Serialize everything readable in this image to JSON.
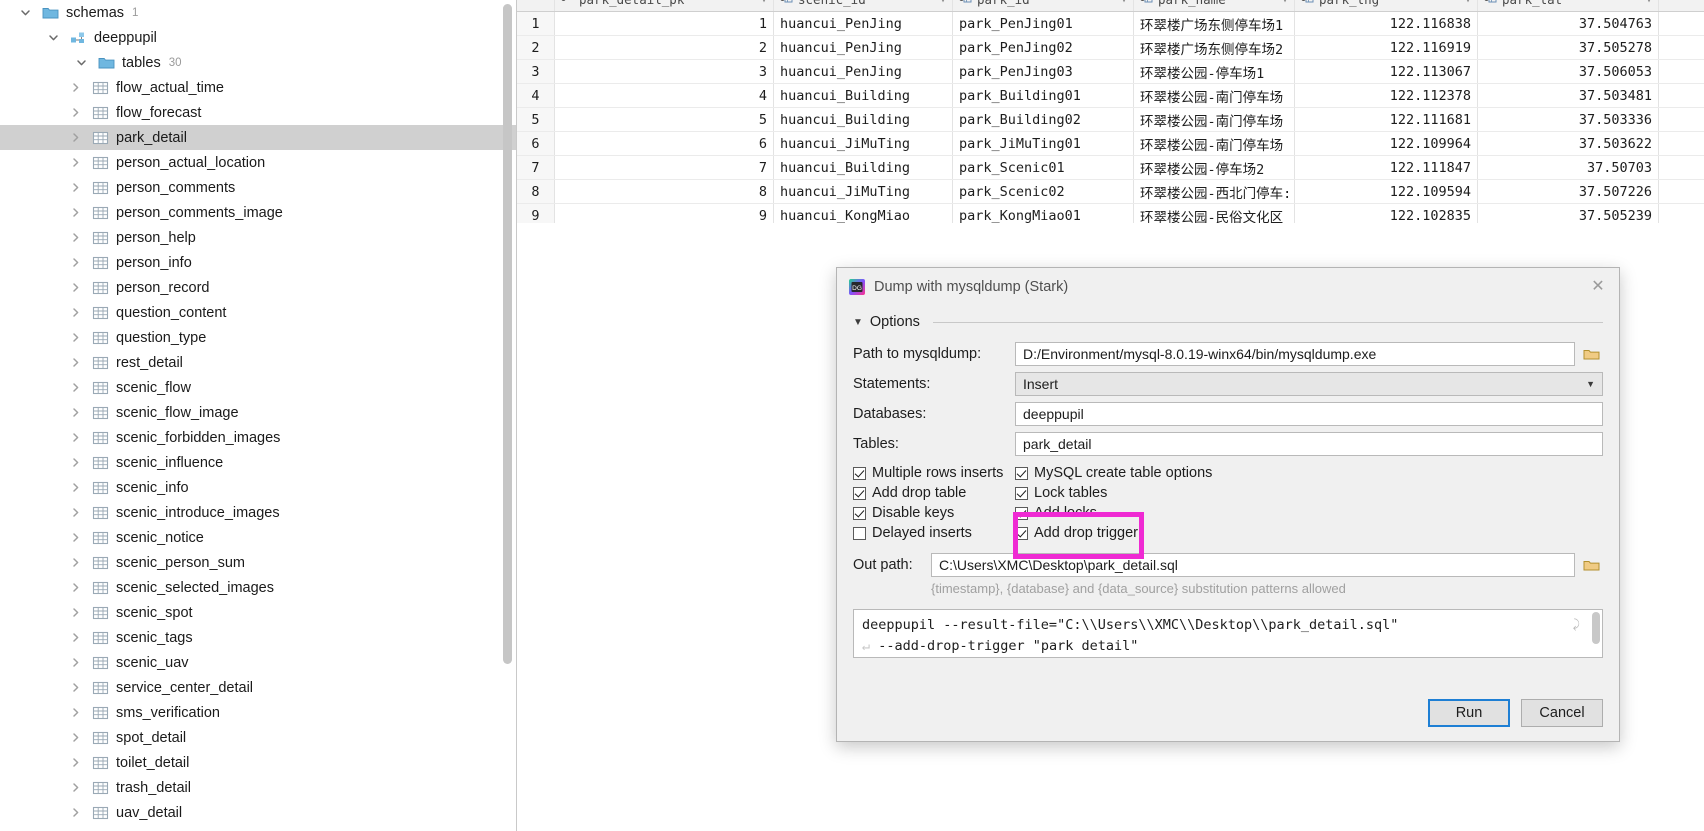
{
  "sidebar": {
    "nodes": [
      {
        "label": "schemas",
        "count": "1",
        "indent": 0,
        "icon": "folder-icon",
        "twisty": "down",
        "selected": false
      },
      {
        "label": "deeppupil",
        "count": "",
        "indent": 1,
        "icon": "database-icon",
        "twisty": "down",
        "selected": false
      },
      {
        "label": "tables",
        "count": "30",
        "indent": 2,
        "icon": "folder-icon",
        "twisty": "down",
        "selected": false
      },
      {
        "label": "flow_actual_time",
        "count": "",
        "indent": 3,
        "icon": "table-icon",
        "twisty": "right",
        "selected": false
      },
      {
        "label": "flow_forecast",
        "count": "",
        "indent": 3,
        "icon": "table-icon",
        "twisty": "right",
        "selected": false
      },
      {
        "label": "park_detail",
        "count": "",
        "indent": 3,
        "icon": "table-icon",
        "twisty": "right",
        "selected": true
      },
      {
        "label": "person_actual_location",
        "count": "",
        "indent": 3,
        "icon": "table-icon",
        "twisty": "right",
        "selected": false
      },
      {
        "label": "person_comments",
        "count": "",
        "indent": 3,
        "icon": "table-icon",
        "twisty": "right",
        "selected": false
      },
      {
        "label": "person_comments_image",
        "count": "",
        "indent": 3,
        "icon": "table-icon",
        "twisty": "right",
        "selected": false
      },
      {
        "label": "person_help",
        "count": "",
        "indent": 3,
        "icon": "table-icon",
        "twisty": "right",
        "selected": false
      },
      {
        "label": "person_info",
        "count": "",
        "indent": 3,
        "icon": "table-icon",
        "twisty": "right",
        "selected": false
      },
      {
        "label": "person_record",
        "count": "",
        "indent": 3,
        "icon": "table-icon",
        "twisty": "right",
        "selected": false
      },
      {
        "label": "question_content",
        "count": "",
        "indent": 3,
        "icon": "table-icon",
        "twisty": "right",
        "selected": false
      },
      {
        "label": "question_type",
        "count": "",
        "indent": 3,
        "icon": "table-icon",
        "twisty": "right",
        "selected": false
      },
      {
        "label": "rest_detail",
        "count": "",
        "indent": 3,
        "icon": "table-icon",
        "twisty": "right",
        "selected": false
      },
      {
        "label": "scenic_flow",
        "count": "",
        "indent": 3,
        "icon": "table-icon",
        "twisty": "right",
        "selected": false
      },
      {
        "label": "scenic_flow_image",
        "count": "",
        "indent": 3,
        "icon": "table-icon",
        "twisty": "right",
        "selected": false
      },
      {
        "label": "scenic_forbidden_images",
        "count": "",
        "indent": 3,
        "icon": "table-icon",
        "twisty": "right",
        "selected": false
      },
      {
        "label": "scenic_influence",
        "count": "",
        "indent": 3,
        "icon": "table-icon",
        "twisty": "right",
        "selected": false
      },
      {
        "label": "scenic_info",
        "count": "",
        "indent": 3,
        "icon": "table-icon",
        "twisty": "right",
        "selected": false
      },
      {
        "label": "scenic_introduce_images",
        "count": "",
        "indent": 3,
        "icon": "table-icon",
        "twisty": "right",
        "selected": false
      },
      {
        "label": "scenic_notice",
        "count": "",
        "indent": 3,
        "icon": "table-icon",
        "twisty": "right",
        "selected": false
      },
      {
        "label": "scenic_person_sum",
        "count": "",
        "indent": 3,
        "icon": "table-icon",
        "twisty": "right",
        "selected": false
      },
      {
        "label": "scenic_selected_images",
        "count": "",
        "indent": 3,
        "icon": "table-icon",
        "twisty": "right",
        "selected": false
      },
      {
        "label": "scenic_spot",
        "count": "",
        "indent": 3,
        "icon": "table-icon",
        "twisty": "right",
        "selected": false
      },
      {
        "label": "scenic_tags",
        "count": "",
        "indent": 3,
        "icon": "table-icon",
        "twisty": "right",
        "selected": false
      },
      {
        "label": "scenic_uav",
        "count": "",
        "indent": 3,
        "icon": "table-icon",
        "twisty": "right",
        "selected": false
      },
      {
        "label": "service_center_detail",
        "count": "",
        "indent": 3,
        "icon": "table-icon",
        "twisty": "right",
        "selected": false
      },
      {
        "label": "sms_verification",
        "count": "",
        "indent": 3,
        "icon": "table-icon",
        "twisty": "right",
        "selected": false
      },
      {
        "label": "spot_detail",
        "count": "",
        "indent": 3,
        "icon": "table-icon",
        "twisty": "right",
        "selected": false
      },
      {
        "label": "toilet_detail",
        "count": "",
        "indent": 3,
        "icon": "table-icon",
        "twisty": "right",
        "selected": false
      },
      {
        "label": "trash_detail",
        "count": "",
        "indent": 3,
        "icon": "table-icon",
        "twisty": "right",
        "selected": false
      },
      {
        "label": "uav_detail",
        "count": "",
        "indent": 3,
        "icon": "table-icon",
        "twisty": "right",
        "selected": false
      }
    ]
  },
  "grid": {
    "columns": [
      {
        "name": "park_detail_pk",
        "icon": "primary-key-icon",
        "align": "right"
      },
      {
        "name": "scenic_id",
        "icon": "column-icon",
        "align": "left"
      },
      {
        "name": "park_id",
        "icon": "column-icon",
        "align": "left"
      },
      {
        "name": "park_name",
        "icon": "column-icon",
        "align": "left"
      },
      {
        "name": "park_lng",
        "icon": "column-icon",
        "align": "right"
      },
      {
        "name": "park_lat",
        "icon": "column-icon",
        "align": "right"
      }
    ],
    "rows": [
      {
        "n": "1",
        "pk": "1",
        "scenic_id": "huancui_PenJing",
        "park_id": "park_PenJing01",
        "park_name": "环翠楼广场东侧停车场1",
        "lng": "122.116838",
        "lat": "37.504763"
      },
      {
        "n": "2",
        "pk": "2",
        "scenic_id": "huancui_PenJing",
        "park_id": "park_PenJing02",
        "park_name": "环翠楼广场东侧停车场2",
        "lng": "122.116919",
        "lat": "37.505278"
      },
      {
        "n": "3",
        "pk": "3",
        "scenic_id": "huancui_PenJing",
        "park_id": "park_PenJing03",
        "park_name": "环翠楼公园-停车场1",
        "lng": "122.113067",
        "lat": "37.506053"
      },
      {
        "n": "4",
        "pk": "4",
        "scenic_id": "huancui_Building",
        "park_id": "park_Building01",
        "park_name": "环翠楼公园-南门停车场",
        "lng": "122.112378",
        "lat": "37.503481"
      },
      {
        "n": "5",
        "pk": "5",
        "scenic_id": "huancui_Building",
        "park_id": "park_Building02",
        "park_name": "环翠楼公园-南门停车场",
        "lng": "122.111681",
        "lat": "37.503336"
      },
      {
        "n": "6",
        "pk": "6",
        "scenic_id": "huancui_JiMuTing",
        "park_id": "park_JiMuTing01",
        "park_name": "环翠楼公园-南门停车场",
        "lng": "122.109964",
        "lat": "37.503622"
      },
      {
        "n": "7",
        "pk": "7",
        "scenic_id": "huancui_Building",
        "park_id": "park_Scenic01",
        "park_name": "环翠楼公园-停车场2",
        "lng": "122.111847",
        "lat": "37.50703"
      },
      {
        "n": "8",
        "pk": "8",
        "scenic_id": "huancui_JiMuTing",
        "park_id": "park_Scenic02",
        "park_name": "环翠楼公园-西北门停车:",
        "lng": "122.109594",
        "lat": "37.507226"
      },
      {
        "n": "9",
        "pk": "9",
        "scenic_id": "huancui_KongMiao",
        "park_id": "park_KongMiao01",
        "park_name": "环翠楼公园-民俗文化区",
        "lng": "122.102835",
        "lat": "37.505239"
      }
    ]
  },
  "dialog": {
    "title": "Dump with mysqldump (Stark)",
    "close_label": "✕",
    "section_label": "Options",
    "fields": [
      {
        "label": "Path to mysqldump:",
        "value": "D:/Environment/mysql-8.0.19-winx64/bin/mysqldump.exe",
        "type": "text",
        "browse": true
      },
      {
        "label": "Statements:",
        "value": "Insert",
        "type": "combo",
        "browse": false
      },
      {
        "label": "Databases:",
        "value": "deeppupil",
        "type": "text",
        "browse": false
      },
      {
        "label": "Tables:",
        "value": "park_detail",
        "type": "text",
        "browse": false
      }
    ],
    "checkboxes_left": [
      {
        "label": "Multiple rows inserts",
        "checked": true
      },
      {
        "label": "Add drop table",
        "checked": true
      },
      {
        "label": "Disable keys",
        "checked": true
      },
      {
        "label": "Delayed inserts",
        "checked": false
      }
    ],
    "checkboxes_right": [
      {
        "label": "MySQL create table options",
        "checked": true
      },
      {
        "label": "Lock tables",
        "checked": true
      },
      {
        "label": "Add locks",
        "checked": true
      },
      {
        "label": "Add drop trigger",
        "checked": true
      }
    ],
    "out_path_label": "Out path:",
    "out_path_value": "C:\\Users\\XMC\\Desktop\\park_detail.sql",
    "out_path_hint": "{timestamp}, {database} and {data_source} substitution patterns allowed",
    "sql_line1": "deeppupil --result-file=\"C:\\\\Users\\\\XMC\\\\Desktop\\\\park_detail.sql\"",
    "sql_line2": "--add-drop-trigger \"park detail\"",
    "run_label": "Run",
    "cancel_label": "Cancel"
  },
  "annotation": {
    "highlight_color": "#ef2ad3",
    "highlight_target": "park_detail.sql"
  }
}
